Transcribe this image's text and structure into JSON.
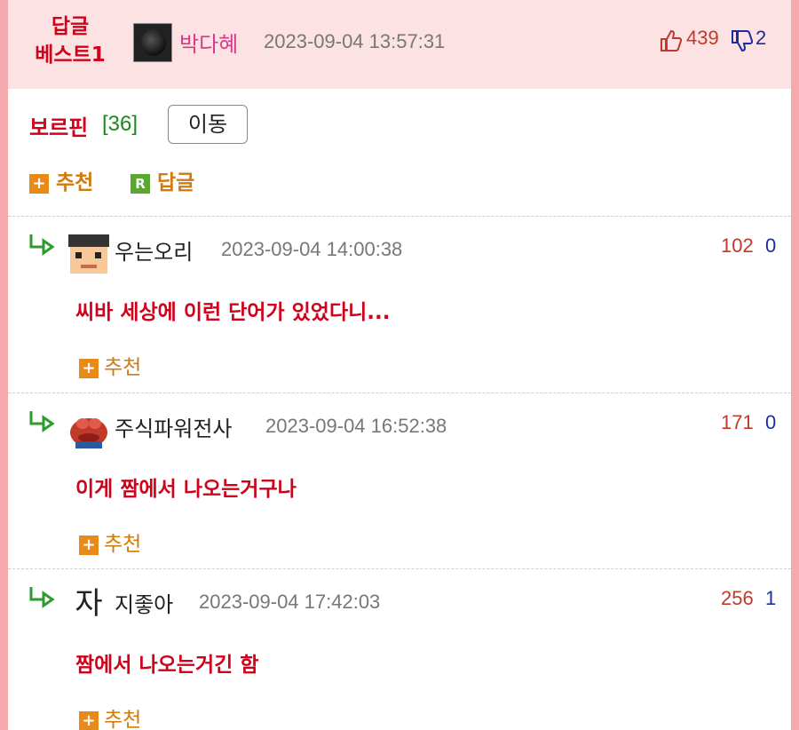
{
  "best": {
    "label_line1": "답글",
    "label_line2": "베스트1",
    "author": "박다혜",
    "time": "2023-09-04 13:57:31",
    "up": "439",
    "down": "2"
  },
  "post": {
    "title": "보르핀",
    "count": "[36]",
    "move_button": "이동",
    "recommend_label": "추천",
    "reply_label": "답글",
    "reply_icon_letter": "R"
  },
  "replies": [
    {
      "author": "우는오리",
      "time": "2023-09-04 14:00:38",
      "up": "102",
      "down": "0",
      "body": "씨바 세상에 이런 단어가 있었다니...",
      "recommend": "추천"
    },
    {
      "author": "주식파워전사",
      "time": "2023-09-04 16:52:38",
      "up": "171",
      "down": "0",
      "body": "이게 짬에서 나오는거구나",
      "recommend": "추천"
    },
    {
      "author": "지좋아",
      "avatar_text": "자",
      "time": "2023-09-04 17:42:03",
      "up": "256",
      "down": "1",
      "body": "짬에서 나오는거긴 함",
      "recommend": "추천"
    }
  ],
  "colors": {
    "accent_red": "#d0021b",
    "header_bg": "#fde2e3",
    "frame_pink": "#f5a9ac",
    "recommend_orange": "#d07a10"
  }
}
